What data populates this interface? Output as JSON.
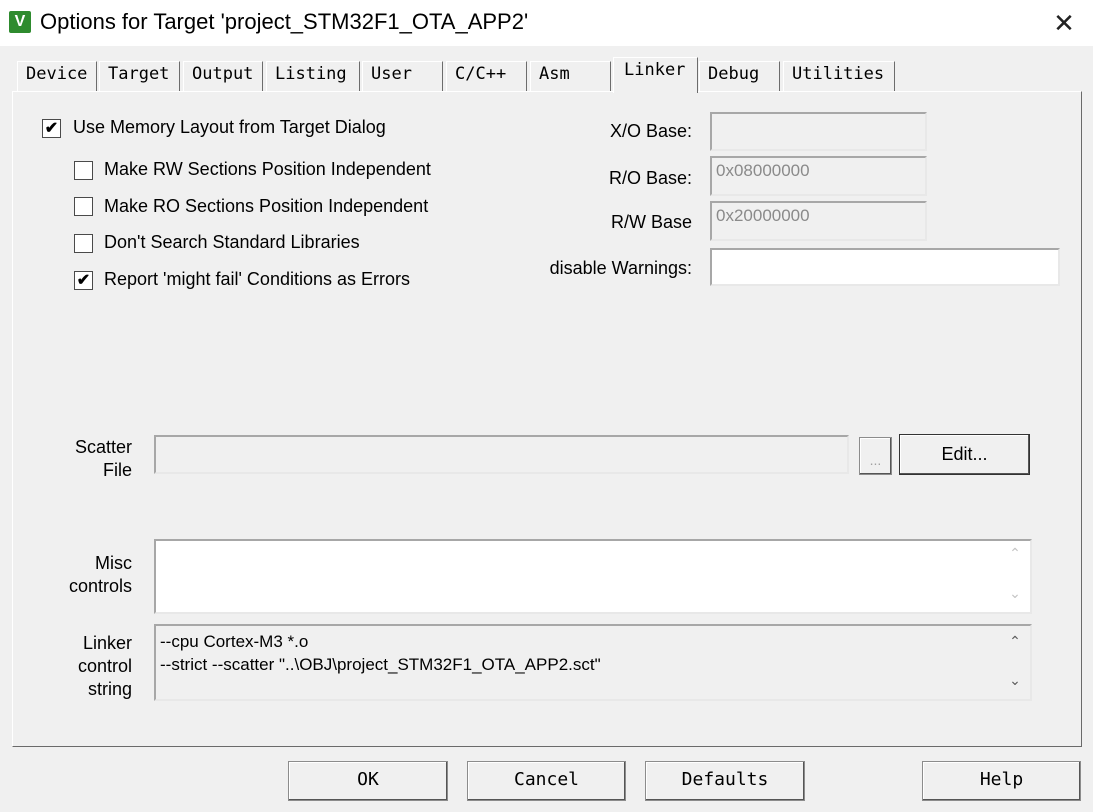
{
  "window": {
    "title": "Options for Target 'project_STM32F1_OTA_APP2'",
    "close": "✕",
    "icon_letter": "V"
  },
  "tabs": [
    {
      "label": "Device"
    },
    {
      "label": "Target"
    },
    {
      "label": "Output"
    },
    {
      "label": "Listing"
    },
    {
      "label": "User"
    },
    {
      "label": "C/C++"
    },
    {
      "label": "Asm"
    },
    {
      "label": "Linker"
    },
    {
      "label": "Debug"
    },
    {
      "label": "Utilities"
    }
  ],
  "active_tab": "Linker",
  "options": {
    "use_memory_layout": {
      "label": "Use Memory Layout from Target Dialog",
      "checked": true
    },
    "rw_position_independent": {
      "label": "Make RW Sections Position Independent",
      "checked": false
    },
    "ro_position_independent": {
      "label": "Make RO Sections Position Independent",
      "checked": false
    },
    "dont_search_libs": {
      "label": "Don't Search Standard Libraries",
      "checked": false
    },
    "report_might_fail": {
      "label": "Report 'might fail' Conditions as Errors",
      "checked": true
    }
  },
  "bases": {
    "xo_label": "X/O Base:",
    "xo_value": "",
    "ro_label": "R/O Base:",
    "ro_value": "0x08000000",
    "rw_label": "R/W Base",
    "rw_value": "0x20000000",
    "warnings_label": "disable Warnings:",
    "warnings_value": ""
  },
  "scatter": {
    "label_line1": "Scatter",
    "label_line2": "File",
    "value": "",
    "browse": "...",
    "edit": "Edit..."
  },
  "misc": {
    "label_line1": "Misc",
    "label_line2": "controls",
    "value": ""
  },
  "linker_string": {
    "label_line1": "Linker",
    "label_line2": "control",
    "label_line3": "string",
    "line1": "--cpu Cortex-M3 *.o",
    "line2": "--strict --scatter \"..\\OBJ\\project_STM32F1_OTA_APP2.sct\""
  },
  "buttons": {
    "ok": "OK",
    "cancel": "Cancel",
    "defaults": "Defaults",
    "help": "Help"
  },
  "check_glyph": "✔",
  "scroll_up": "⌃",
  "scroll_down": "⌄"
}
